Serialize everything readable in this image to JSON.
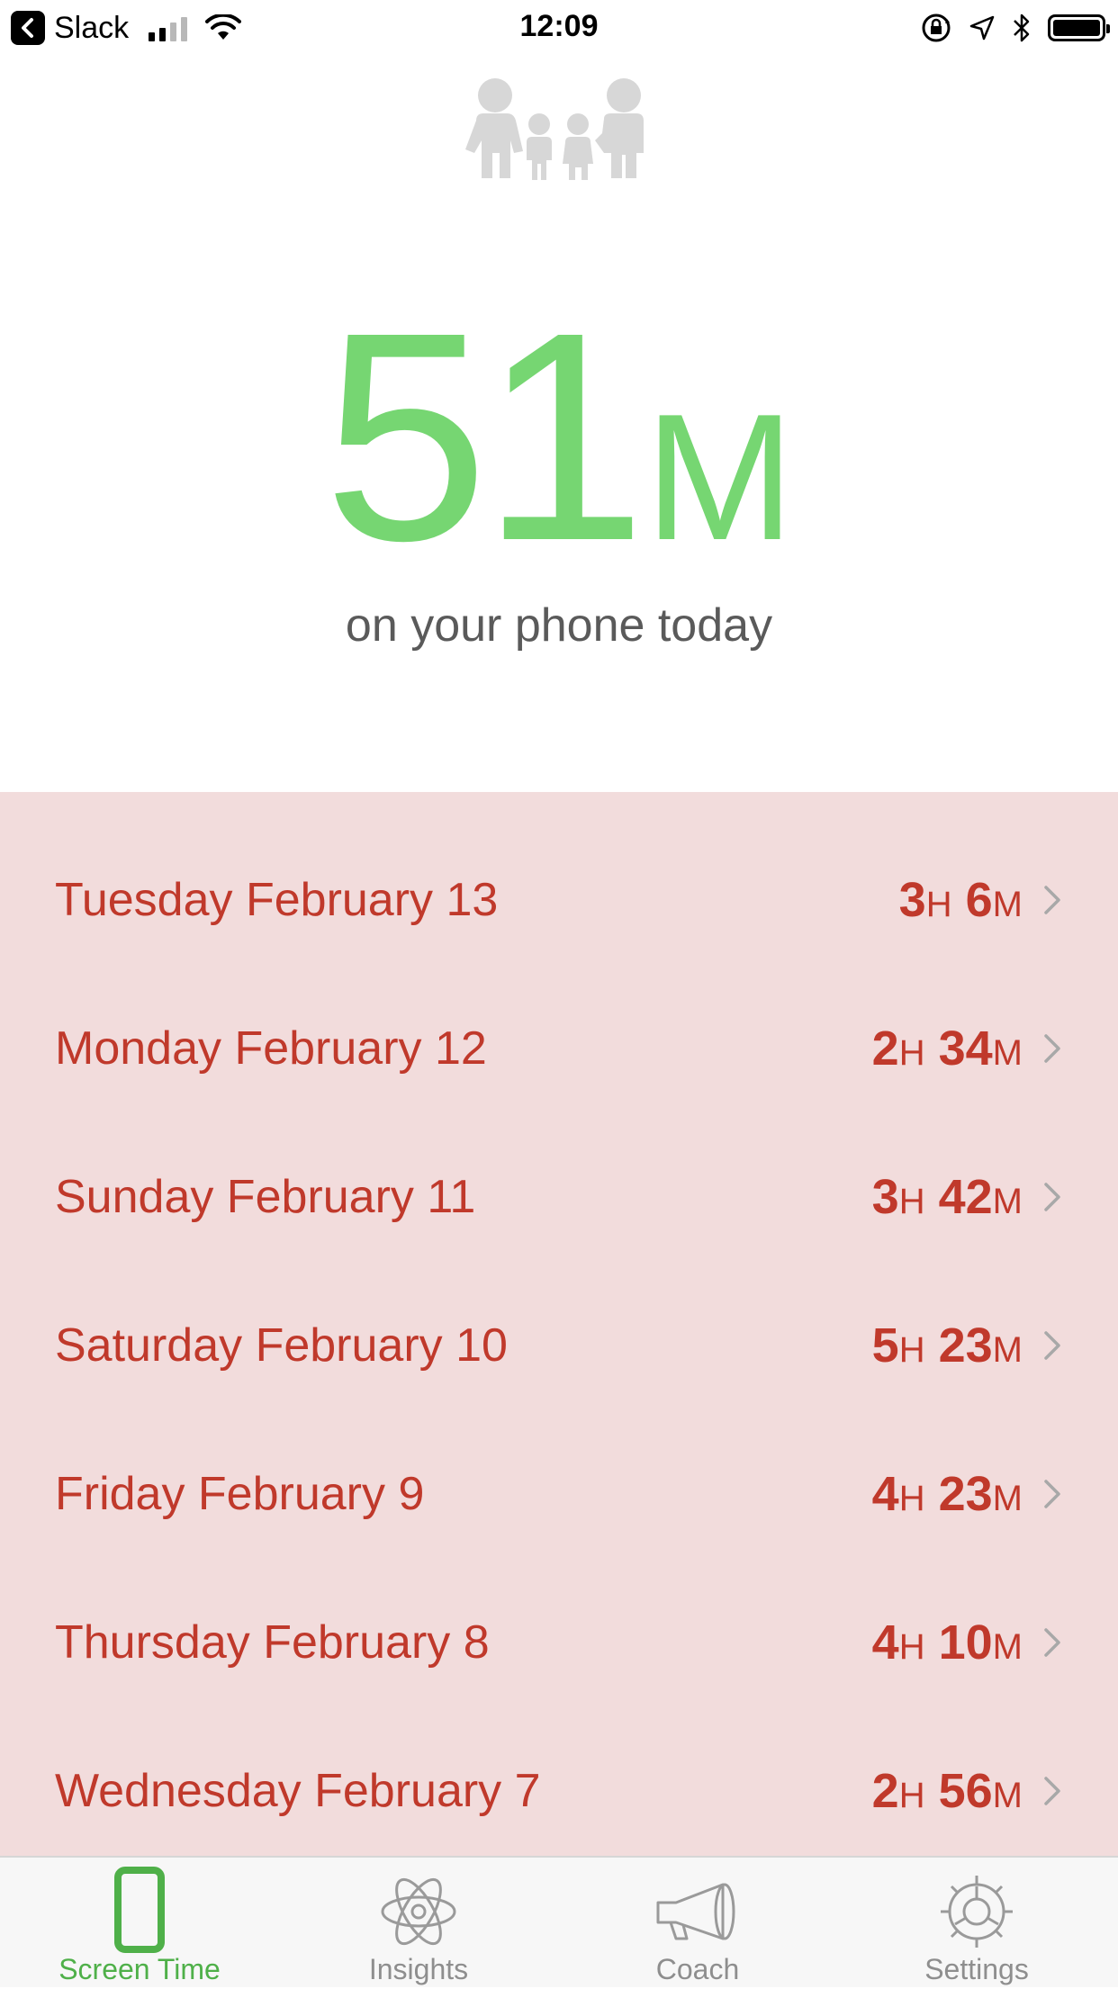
{
  "status_bar": {
    "back_app": "Slack",
    "time": "12:09"
  },
  "hero": {
    "minutes_value": "51",
    "minutes_unit": "M",
    "subtitle": "on your phone today",
    "accent_color": "#76d672"
  },
  "days": [
    {
      "date": "Tuesday February 13",
      "hours": "3",
      "h_unit": "H",
      "minutes": "6",
      "m_unit": "M"
    },
    {
      "date": "Monday February 12",
      "hours": "2",
      "h_unit": "H",
      "minutes": "34",
      "m_unit": "M"
    },
    {
      "date": "Sunday February 11",
      "hours": "3",
      "h_unit": "H",
      "minutes": "42",
      "m_unit": "M"
    },
    {
      "date": "Saturday February 10",
      "hours": "5",
      "h_unit": "H",
      "minutes": "23",
      "m_unit": "M"
    },
    {
      "date": "Friday February 9",
      "hours": "4",
      "h_unit": "H",
      "minutes": "23",
      "m_unit": "M"
    },
    {
      "date": "Thursday February 8",
      "hours": "4",
      "h_unit": "H",
      "minutes": "10",
      "m_unit": "M"
    },
    {
      "date": "Wednesday February 7",
      "hours": "2",
      "h_unit": "H",
      "minutes": "56",
      "m_unit": "M"
    }
  ],
  "tabs": [
    {
      "label": "Screen Time",
      "icon": "phone-icon",
      "active": true
    },
    {
      "label": "Insights",
      "icon": "atom-icon",
      "active": false
    },
    {
      "label": "Coach",
      "icon": "megaphone-icon",
      "active": false
    },
    {
      "label": "Settings",
      "icon": "gear-icon",
      "active": false
    }
  ],
  "colors": {
    "list_bg": "#f2dcdc",
    "list_text": "#c0392b",
    "active_tab": "#4fb049"
  }
}
